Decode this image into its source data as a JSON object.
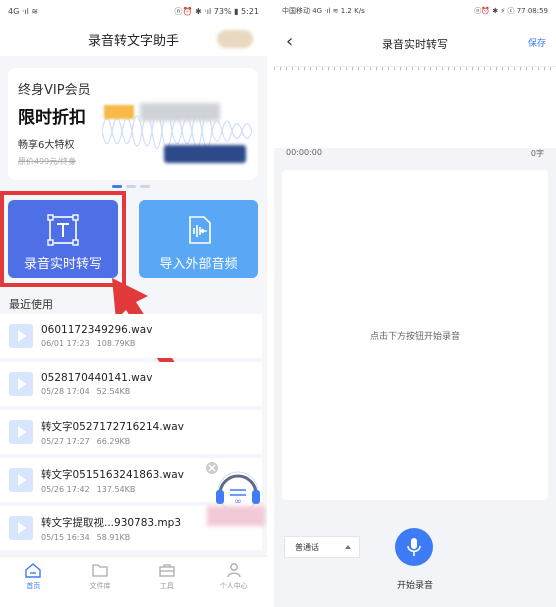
{
  "left": {
    "status": {
      "left": "4G ·ıl ≋",
      "right": "ⓝ⏰ ✱ ·ıl 73% ▮ 5:21"
    },
    "title": "录音转文字助手",
    "vip": {
      "line1": "终身VIP会员",
      "line2": "限时折扣",
      "line3": "畅享6大特权",
      "line4": "原价499元/终身"
    },
    "actions": {
      "record": "录音实时转写",
      "import": "导入外部音频"
    },
    "recent_title": "最近使用",
    "files": [
      {
        "name": "0601172349296.wav",
        "date": "06/01 17:23",
        "size": "108.79KB"
      },
      {
        "name": "0528170440141.wav",
        "date": "05/28 17:04",
        "size": "52.54KB"
      },
      {
        "name": "转文字0527172716214.wav",
        "date": "05/27 17:27",
        "size": "66.29KB"
      },
      {
        "name": "转文字0515163241863.wav",
        "date": "05/26 17:42",
        "size": "137.54KB"
      },
      {
        "name": "转文字提取视...930783.mp3",
        "date": "05/15 16:34",
        "size": "58.91KB"
      }
    ],
    "tabs": [
      {
        "label": "首页",
        "icon": "home-icon"
      },
      {
        "label": "文件库",
        "icon": "folder-icon"
      },
      {
        "label": "工具",
        "icon": "toolbox-icon"
      },
      {
        "label": "个人中心",
        "icon": "person-icon"
      }
    ],
    "active_tab": 0
  },
  "right": {
    "status": {
      "left": "中国移动 4G ·ıl ≋ 1.2 K/s",
      "right": "ⓝ⏰ ✱ ⚡ ⓒ 77 08:59"
    },
    "title": "录音实时转写",
    "save": "保存",
    "timer": "00:00:00",
    "word_count": "0字",
    "hint": "点击下方按钮开始录音",
    "language": "普通话",
    "start_label": "开始录音"
  },
  "colors": {
    "accent": "#3d7bf7",
    "record_btn": "#4f6fe6",
    "import_btn": "#5aa7f5",
    "highlight": "#e23a3a"
  }
}
